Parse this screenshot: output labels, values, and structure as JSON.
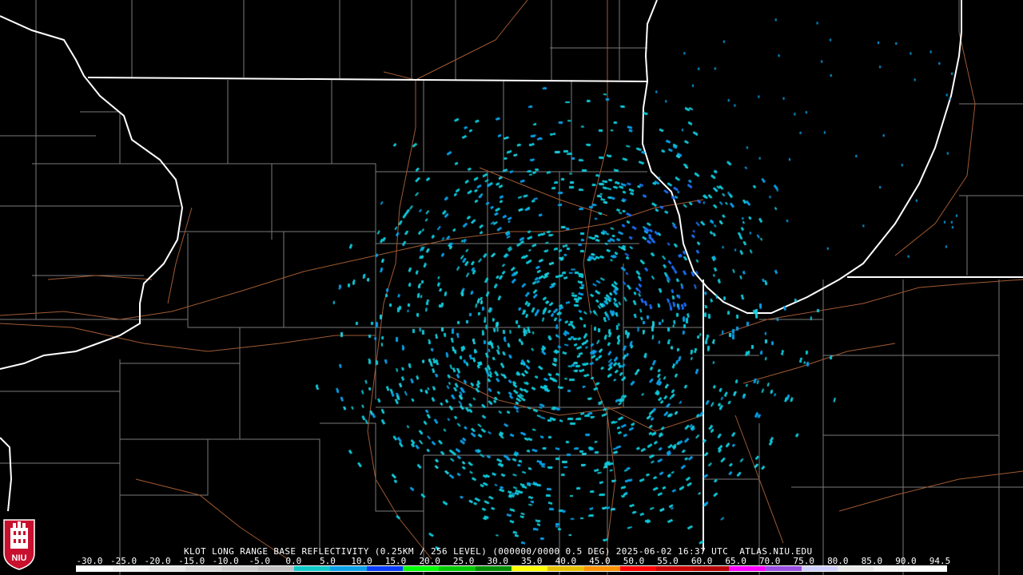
{
  "product": {
    "caption": "KLOT LONG RANGE BASE REFLECTIVITY (0.25KM / 256 LEVEL) (000000/0000 0.5 DEG) 2025-06-02 16:37 UTC  ATLAS.NIU.EDU"
  },
  "scale": {
    "labels": [
      "-30.0",
      "-25.0",
      "-20.0",
      "-15.0",
      "-10.0",
      "-5.0",
      "0.0",
      "5.0",
      "10.0",
      "15.0",
      "20.0",
      "25.0",
      "30.0",
      "35.0",
      "40.0",
      "45.0",
      "50.0",
      "55.0",
      "60.0",
      "65.0",
      "70.0",
      "75.0",
      "80.0",
      "85.0",
      "90.0",
      "94.5"
    ],
    "colors": [
      "#ffffff",
      "#f2f2f2",
      "#e6e6e6",
      "#d9d9d9",
      "#cccccc",
      "#c0c0c0",
      "#10c8c8",
      "#09a0e8",
      "#0a3cff",
      "#00ff00",
      "#00c800",
      "#008c00",
      "#ffff00",
      "#e6c000",
      "#ff9000",
      "#ff0000",
      "#c80000",
      "#b40000",
      "#ff00ff",
      "#9a4ee0",
      "#d0d0ff",
      "#e8e8e8",
      "#f4f4f4",
      "#ffffff"
    ]
  },
  "map": {
    "state_line_color": "#ffffff",
    "county_line_color": "#8c8c8c",
    "highway_color": "#a05a32",
    "echo_colors": [
      "#10c8d8",
      "#09a0e8",
      "#1e6ef0",
      "#20d0e0"
    ]
  },
  "logo": {
    "text": "NIU",
    "color": "#c8102e"
  }
}
